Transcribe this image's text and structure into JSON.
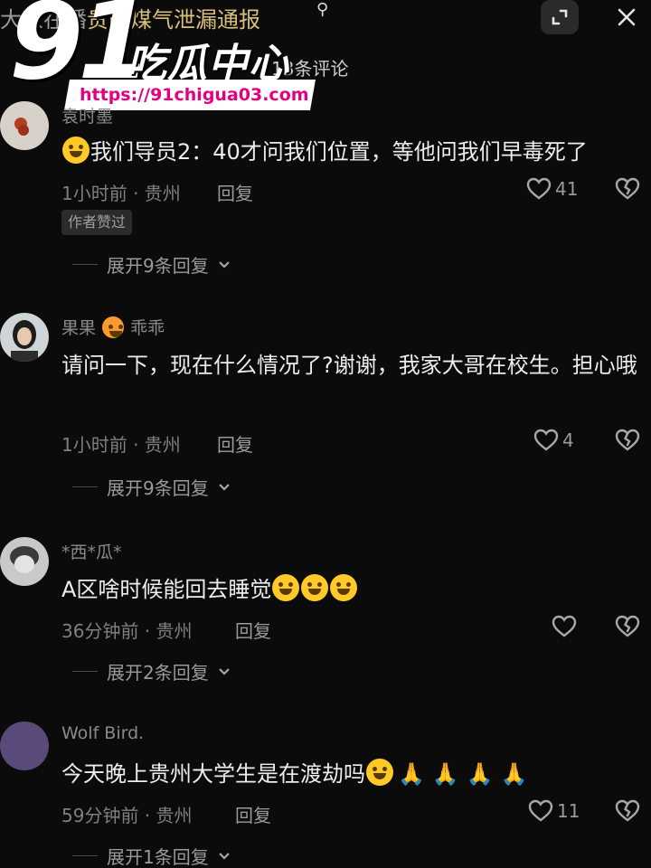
{
  "header": {
    "title_prefix": "大家",
    "title_mid": "在播",
    "title": "贵医煤气泄漏通报",
    "comment_count": "13条评论"
  },
  "watermark": {
    "number": "91",
    "brand": "吃瓜中心",
    "url": "https://91chigua03.com"
  },
  "comments": [
    {
      "username": "袁时墨",
      "text": "我们导员2：40才问我们位置，等他问我们早毒死了",
      "time": "1小时前 · 贵州",
      "reply_label": "回复",
      "likes": "41",
      "badge": "作者赞过",
      "expand": "展开9条回复"
    },
    {
      "username": "果果",
      "username_suffix": "乖乖",
      "text": "请问一下，现在什么情况了?谢谢，我家大哥在校生。担心哦",
      "time": "1小时前 · 贵州",
      "reply_label": "回复",
      "likes": "4",
      "expand": "展开9条回复"
    },
    {
      "username": "*西*瓜*",
      "text": "A区啥时候能回去睡觉",
      "time": "36分钟前 · 贵州",
      "reply_label": "回复",
      "likes": "",
      "expand": "展开2条回复"
    },
    {
      "username": "Wolf Bird.",
      "text": "今天晚上贵州大学生是在渡劫吗",
      "time": "59分钟前 · 贵州",
      "reply_label": "回复",
      "likes": "11",
      "expand": "展开1条回复"
    }
  ],
  "icons": {
    "like": "heart-outline-icon",
    "dislike": "broken-heart-icon",
    "expand": "expand-screen-icon",
    "close": "close-icon",
    "search": "search-icon",
    "chevron": "chevron-down-icon"
  }
}
